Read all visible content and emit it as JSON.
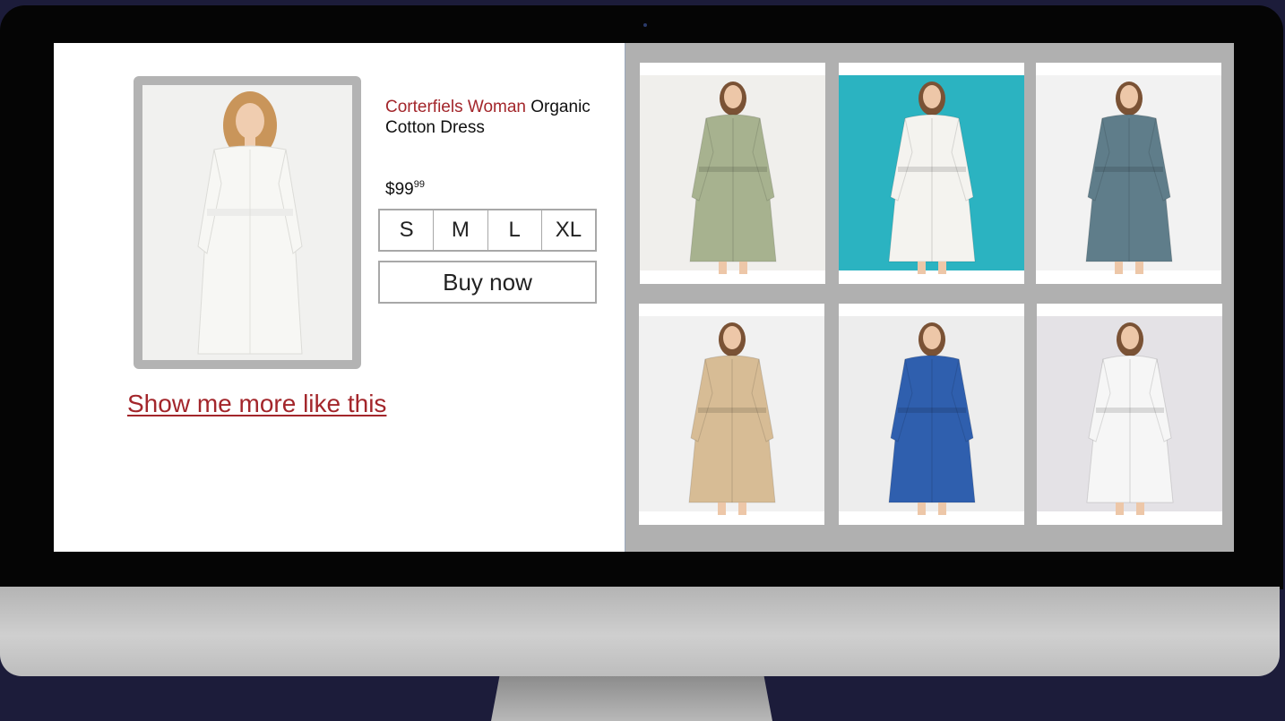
{
  "product": {
    "brand": "Corterfiels Woman",
    "name": " Organic Cotton Dress",
    "price_main": "$99",
    "price_cents": "99",
    "sizes": [
      "S",
      "M",
      "L",
      "XL"
    ],
    "buy_label": "Buy now",
    "more_link": "Show me more like this"
  },
  "colors": {
    "brand": "#a3262b",
    "grid_bg": "#b0b0b0",
    "main_dress": "#f7f7f4"
  },
  "similar_items": [
    {
      "dress_color": "#a7b28f",
      "backdrop": "#f0efec",
      "description": "sage-green-shirt-dress"
    },
    {
      "dress_color": "#f4f3ef",
      "backdrop": "#2bb3c1",
      "description": "white-embroidered-shirt-dress"
    },
    {
      "dress_color": "#5f7d8a",
      "backdrop": "#f2f2f2",
      "description": "teal-print-shirt-dress"
    },
    {
      "dress_color": "#d7bc95",
      "backdrop": "#f1f1f1",
      "description": "beige-belted-dress"
    },
    {
      "dress_color": "#2f5fae",
      "backdrop": "#ededed",
      "description": "blue-shirt-dress"
    },
    {
      "dress_color": "#f6f6f6",
      "backdrop": "#e4e2e6",
      "description": "white-floral-shirt-dress"
    }
  ]
}
